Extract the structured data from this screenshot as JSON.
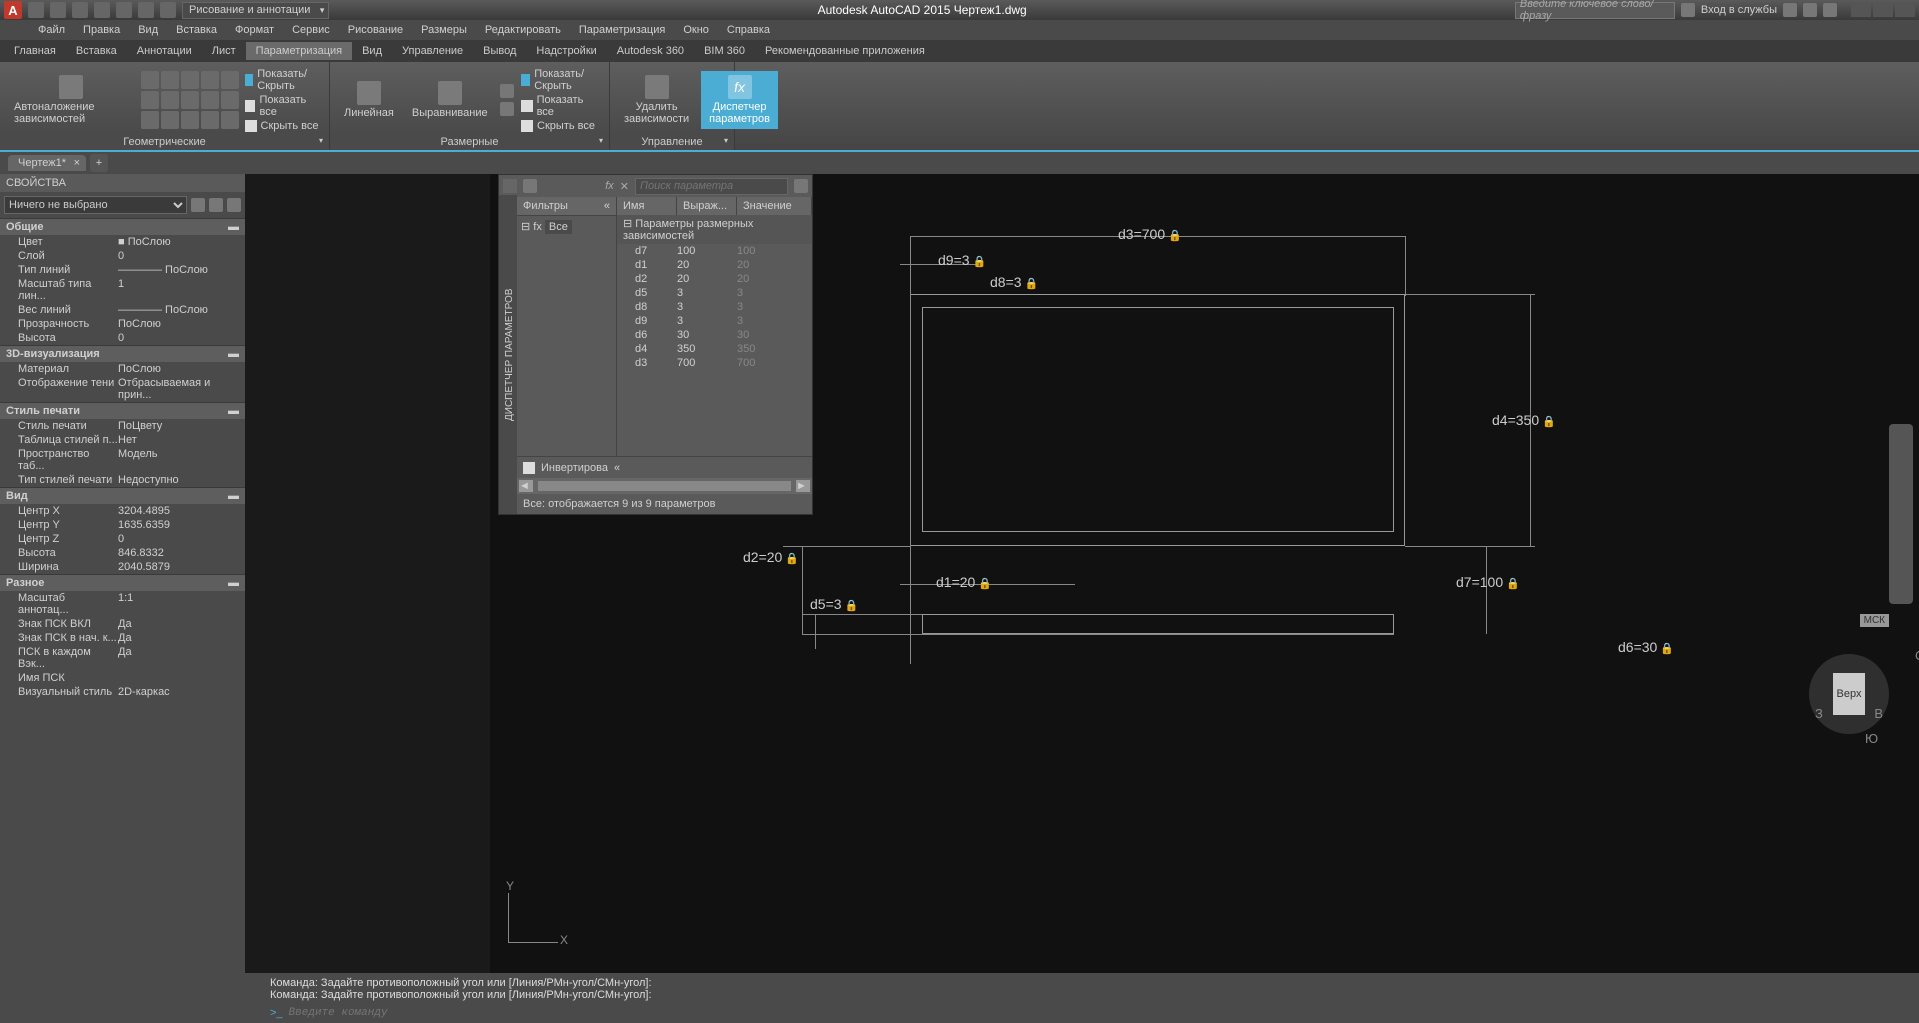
{
  "app": {
    "title": "Autodesk AutoCAD 2015    Чертеж1.dwg"
  },
  "qat": {
    "workspace": "Рисование и аннотации"
  },
  "search": {
    "placeholder": "Введите ключевое слово/фразу"
  },
  "login": "Вход в службы",
  "menus": [
    "Файл",
    "Правка",
    "Вид",
    "Вставка",
    "Формат",
    "Сервис",
    "Рисование",
    "Размеры",
    "Редактировать",
    "Параметризация",
    "Окно",
    "Справка"
  ],
  "ribbon_tabs": [
    "Главная",
    "Вставка",
    "Аннотации",
    "Лист",
    "Параметризация",
    "Вид",
    "Управление",
    "Вывод",
    "Надстройки",
    "Autodesk 360",
    "BIM 360",
    "Рекомендованные приложения"
  ],
  "ribbon_active": 4,
  "ribbon": {
    "p1": {
      "label": "Геометрические",
      "big": "Автоналожение зависимостей",
      "chk1": "Показать/Скрыть",
      "chk2": "Показать все",
      "chk3": "Скрыть все"
    },
    "p2": {
      "label": "Размерные",
      "b1": "Линейная",
      "b2": "Выравнивание",
      "chk1": "Показать/Скрыть",
      "chk2": "Показать все",
      "chk3": "Скрыть все"
    },
    "p3": {
      "label": "Управление",
      "b1": "Удалить\nзависимости",
      "b2": "Диспетчер\nпараметров"
    }
  },
  "doc_tab": "Чертеж1*",
  "properties": {
    "title": "СВОЙСТВА",
    "selection": "Ничего не выбрано",
    "sections": [
      {
        "name": "Общие",
        "rows": [
          {
            "n": "Цвет",
            "v": "■ ПоСлою"
          },
          {
            "n": "Слой",
            "v": "0"
          },
          {
            "n": "Тип линий",
            "v": "———— ПоСлою"
          },
          {
            "n": "Масштаб типа лин...",
            "v": "1"
          },
          {
            "n": "Вес линий",
            "v": "———— ПоСлою"
          },
          {
            "n": "Прозрачность",
            "v": "ПоСлою"
          },
          {
            "n": "Высота",
            "v": "0"
          }
        ]
      },
      {
        "name": "3D-визуализация",
        "rows": [
          {
            "n": "Материал",
            "v": "ПоСлою"
          },
          {
            "n": "Отображение тени",
            "v": "Отбрасываемая и прин..."
          }
        ]
      },
      {
        "name": "Стиль печати",
        "rows": [
          {
            "n": "Стиль печати",
            "v": "ПоЦвету"
          },
          {
            "n": "Таблица стилей п...",
            "v": "Нет"
          },
          {
            "n": "Пространство таб...",
            "v": "Модель"
          },
          {
            "n": "Тип стилей печати",
            "v": "Недоступно"
          }
        ]
      },
      {
        "name": "Вид",
        "rows": [
          {
            "n": "Центр X",
            "v": "3204.4895"
          },
          {
            "n": "Центр Y",
            "v": "1635.6359"
          },
          {
            "n": "Центр Z",
            "v": "0"
          },
          {
            "n": "Высота",
            "v": "846.8332"
          },
          {
            "n": "Ширина",
            "v": "2040.5879"
          }
        ]
      },
      {
        "name": "Разное",
        "rows": [
          {
            "n": "Масштаб аннотац...",
            "v": "1:1"
          },
          {
            "n": "Знак ПСК ВКЛ",
            "v": "Да"
          },
          {
            "n": "Знак ПСК в нач. к...",
            "v": "Да"
          },
          {
            "n": "ПСК в каждом Вэк...",
            "v": "Да"
          },
          {
            "n": "Имя ПСК",
            "v": ""
          },
          {
            "n": "Визуальный стиль",
            "v": "2D-каркас"
          }
        ]
      }
    ]
  },
  "param_mgr": {
    "vtitle": "ДИСПЕТЧЕР ПАРАМЕТРОВ",
    "search": "Поиск параметра",
    "filter_head": "Фильтры",
    "filter_all": "Все",
    "cols": {
      "name": "Имя",
      "expr": "Выраж...",
      "val": "Значение"
    },
    "group": "Параметры размерных зависимостей",
    "rows": [
      {
        "n": "d7",
        "e": "100",
        "v": "100"
      },
      {
        "n": "d1",
        "e": "20",
        "v": "20"
      },
      {
        "n": "d2",
        "e": "20",
        "v": "20"
      },
      {
        "n": "d5",
        "e": "3",
        "v": "3"
      },
      {
        "n": "d8",
        "e": "3",
        "v": "3"
      },
      {
        "n": "d9",
        "e": "3",
        "v": "3"
      },
      {
        "n": "d6",
        "e": "30",
        "v": "30"
      },
      {
        "n": "d4",
        "e": "350",
        "v": "350"
      },
      {
        "n": "d3",
        "e": "700",
        "v": "700"
      }
    ],
    "invert": "Инвертирова",
    "status": "Все: отображается 9 из 9 параметров"
  },
  "drawing": {
    "dims": {
      "d1": "d1=20",
      "d2": "d2=20",
      "d3": "d3=700",
      "d4": "d4=350",
      "d5": "d5=3",
      "d6": "d6=30",
      "d7": "d7=100",
      "d8": "d8=3",
      "d9": "d9=3"
    },
    "viewcube": "Верх",
    "mck": "МСК",
    "east": "В",
    "west": "З",
    "south": "Ю",
    "north": "С"
  },
  "cmd": {
    "hist1": "Команда: Задайте противоположный угол или [Линия/РМн-угол/СМн-угол]:",
    "hist2": "Команда: Задайте противоположный угол или [Линия/РМн-угол/СМн-угол]:",
    "prompt": ">_",
    "placeholder": "Введите команду"
  },
  "ucs": {
    "x": "X",
    "y": "Y"
  }
}
